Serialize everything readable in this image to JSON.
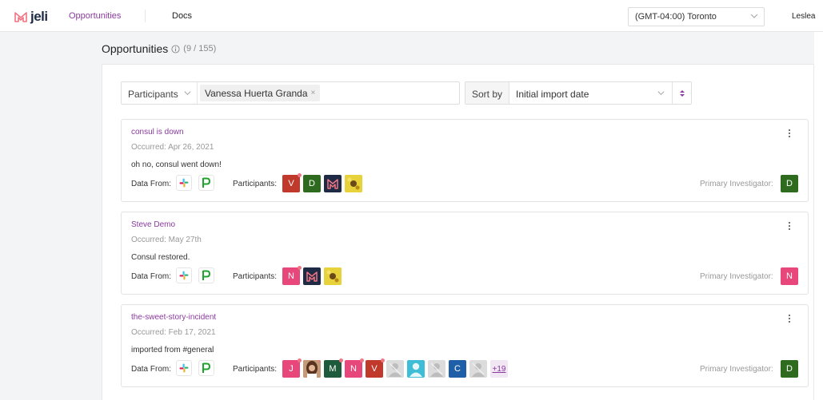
{
  "nav": {
    "logo_text": "jeli",
    "opportunities": "Opportunities",
    "docs": "Docs",
    "timezone": "(GMT-04:00) Toronto",
    "user": "Leslea"
  },
  "page": {
    "title": "Opportunities",
    "count": "(9 / 155)"
  },
  "filter": {
    "label": "Participants",
    "chip": "Vanessa Huerta Granda",
    "chip_remove": "×"
  },
  "sort": {
    "label": "Sort by",
    "value": "Initial import date"
  },
  "card_labels": {
    "data_from": "Data From:",
    "participants": "Participants:",
    "primary_investigator": "Primary Investigator:"
  },
  "cards": [
    {
      "title": "consul is down",
      "occurred": "Occurred: Apr 26, 2021",
      "description": "oh no, consul went down!",
      "participants": [
        {
          "kind": "letter",
          "text": "V",
          "color": "#c0392b",
          "dot": true
        },
        {
          "kind": "letter",
          "text": "D",
          "color": "#2e6b1f",
          "dot": false
        },
        {
          "kind": "logo",
          "text": "",
          "color": "#1f2a44",
          "dot": false
        },
        {
          "kind": "photo",
          "text": "",
          "color": "#d9c238",
          "dot": false
        }
      ],
      "investigator": {
        "text": "D",
        "color": "#2e6b1f"
      }
    },
    {
      "title": "Steve Demo",
      "occurred": "Occurred: May 27th",
      "description": "Consul restored.",
      "participants": [
        {
          "kind": "letter",
          "text": "N",
          "color": "#e8477b",
          "dot": true
        },
        {
          "kind": "logo",
          "text": "",
          "color": "#1f2a44",
          "dot": false
        },
        {
          "kind": "photo",
          "text": "",
          "color": "#d9c238",
          "dot": false
        }
      ],
      "investigator": {
        "text": "N",
        "color": "#e8477b"
      }
    },
    {
      "title": "the-sweet-story-incident",
      "occurred": "Occurred: Feb 17, 2021",
      "description": "imported from #general",
      "participants": [
        {
          "kind": "letter",
          "text": "J",
          "color": "#e8477b",
          "dot": true
        },
        {
          "kind": "person",
          "text": "",
          "color": "#8a5a3a",
          "dot": true
        },
        {
          "kind": "letter",
          "text": "M",
          "color": "#1e5a3c",
          "dot": true
        },
        {
          "kind": "letter",
          "text": "N",
          "color": "#e8477b",
          "dot": true
        },
        {
          "kind": "letter",
          "text": "V",
          "color": "#c0392b",
          "dot": true
        },
        {
          "kind": "ghost",
          "text": "",
          "color": "#dcdcdc",
          "dot": false
        },
        {
          "kind": "profile",
          "text": "",
          "color": "#3fbcd6",
          "dot": false
        },
        {
          "kind": "ghost",
          "text": "",
          "color": "#dcdcdc",
          "dot": false
        },
        {
          "kind": "letter",
          "text": "C",
          "color": "#1f5fa8",
          "dot": false
        },
        {
          "kind": "ghost",
          "text": "",
          "color": "#dcdcdc",
          "dot": false
        },
        {
          "kind": "more",
          "text": "+19",
          "color": "#f0e6f4",
          "dot": false
        }
      ],
      "investigator": {
        "text": "D",
        "color": "#2e6b1f"
      }
    }
  ]
}
